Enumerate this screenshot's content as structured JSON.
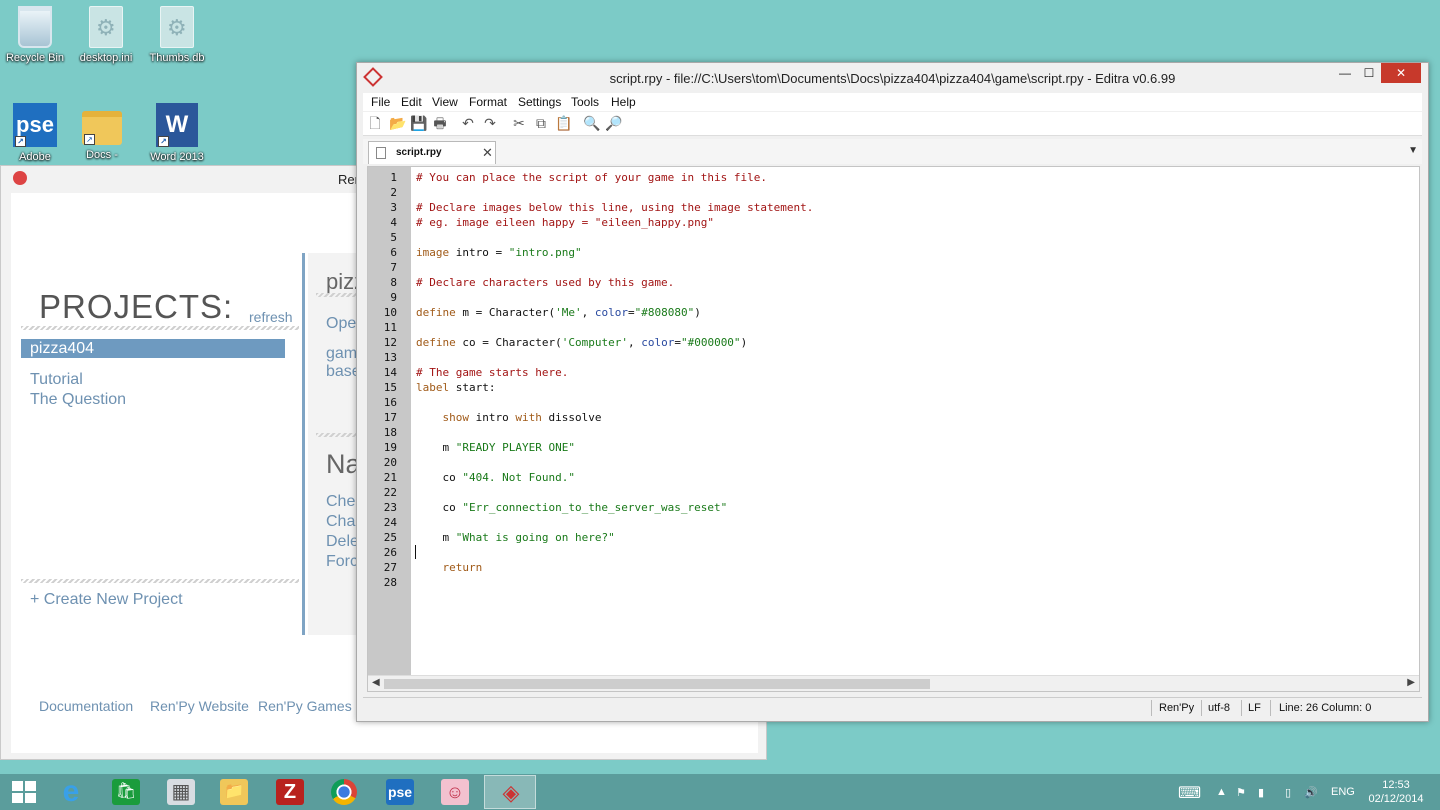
{
  "desktop": {
    "icons": [
      {
        "label": "Recycle Bin",
        "icon": "recycle-bin-icon"
      },
      {
        "label": "desktop.ini",
        "icon": "settings-file-icon"
      },
      {
        "label": "Thumbs.db",
        "icon": "settings-file-icon"
      },
      {
        "label": "Adobe",
        "icon": "photoshop-elements-icon",
        "glyph": "pse"
      },
      {
        "label": "Docs -",
        "icon": "folder-icon"
      },
      {
        "label": "Word 2013",
        "icon": "word-icon",
        "glyph": "W"
      }
    ]
  },
  "launcher": {
    "title": "Ren",
    "projects_heading": "PROJECTS:",
    "refresh": "refresh",
    "selected_project": "pizza404",
    "other_projects": [
      "Tutorial",
      "The Question"
    ],
    "panel": {
      "title": "pizz",
      "open": "Ope",
      "game": "gam",
      "base": "base",
      "nav_heading": "Na",
      "nav_items": [
        "Chec",
        "Char",
        "Dele",
        "Forc"
      ]
    },
    "create_project": "+ Create New Project",
    "footer_links": [
      "Documentation",
      "Ren'Py Website",
      "Ren'Py Games Li"
    ]
  },
  "editra": {
    "title": "script.rpy - file://C:\\Users\\tom\\Documents\\Docs\\pizza404\\pizza404\\game\\script.rpy - Editra v0.6.99",
    "window_buttons": {
      "minimize": "—",
      "maximize": "☐",
      "close": "✕"
    },
    "menu": [
      "File",
      "Edit",
      "View",
      "Format",
      "Settings",
      "Tools",
      "Help"
    ],
    "toolbar": [
      {
        "name": "new-file-icon",
        "glyph": "🗋"
      },
      {
        "name": "open-folder-icon",
        "glyph": "📂"
      },
      {
        "name": "save-icon",
        "glyph": "💾"
      },
      {
        "name": "print-icon",
        "glyph": "🖶"
      },
      {
        "name": "undo-icon",
        "glyph": "↶"
      },
      {
        "name": "redo-icon",
        "glyph": "↷"
      },
      {
        "name": "cut-icon",
        "glyph": "✂"
      },
      {
        "name": "copy-icon",
        "glyph": "⧉"
      },
      {
        "name": "paste-icon",
        "glyph": "📋"
      },
      {
        "name": "find-icon",
        "glyph": "🔍"
      },
      {
        "name": "find-replace-icon",
        "glyph": "🔎"
      }
    ],
    "tab": {
      "label": "script.rpy",
      "close": "✕"
    },
    "tab_dropdown": "▼",
    "lines": [
      [
        {
          "t": "# You can place the script of your game in this file.",
          "c": "comment"
        }
      ],
      [],
      [
        {
          "t": "# Declare images below this line, using the image statement.",
          "c": "comment"
        }
      ],
      [
        {
          "t": "# eg. image eileen happy = \"eileen_happy.png\"",
          "c": "comment"
        }
      ],
      [],
      [
        {
          "t": "image",
          "c": "kw"
        },
        {
          "t": " intro = ",
          "c": ""
        },
        {
          "t": "\"intro.png\"",
          "c": "str"
        }
      ],
      [],
      [
        {
          "t": "# Declare characters used by this game.",
          "c": "comment"
        }
      ],
      [],
      [
        {
          "t": "define",
          "c": "kw"
        },
        {
          "t": " m = Character(",
          "c": ""
        },
        {
          "t": "'Me'",
          "c": "str"
        },
        {
          "t": ", ",
          "c": ""
        },
        {
          "t": "color",
          "c": "attr"
        },
        {
          "t": "=",
          "c": ""
        },
        {
          "t": "\"#808080\"",
          "c": "str"
        },
        {
          "t": ")",
          "c": ""
        }
      ],
      [],
      [
        {
          "t": "define",
          "c": "kw"
        },
        {
          "t": " co = Character(",
          "c": ""
        },
        {
          "t": "'Computer'",
          "c": "str"
        },
        {
          "t": ", ",
          "c": ""
        },
        {
          "t": "color",
          "c": "attr"
        },
        {
          "t": "=",
          "c": ""
        },
        {
          "t": "\"#000000\"",
          "c": "str"
        },
        {
          "t": ")",
          "c": ""
        }
      ],
      [],
      [
        {
          "t": "# The game starts here.",
          "c": "comment"
        }
      ],
      [
        {
          "t": "label",
          "c": "kw"
        },
        {
          "t": " start:",
          "c": ""
        }
      ],
      [],
      [
        {
          "t": "    ",
          "c": ""
        },
        {
          "t": "show",
          "c": "kw"
        },
        {
          "t": " intro ",
          "c": ""
        },
        {
          "t": "with",
          "c": "kw"
        },
        {
          "t": " dissolve",
          "c": ""
        }
      ],
      [],
      [
        {
          "t": "    m ",
          "c": ""
        },
        {
          "t": "\"READY PLAYER ONE\"",
          "c": "str"
        }
      ],
      [],
      [
        {
          "t": "    co ",
          "c": ""
        },
        {
          "t": "\"404. Not Found.\"",
          "c": "str"
        }
      ],
      [],
      [
        {
          "t": "    co ",
          "c": ""
        },
        {
          "t": "\"Err_connection_to_the_server_was_reset\"",
          "c": "str"
        }
      ],
      [],
      [
        {
          "t": "    m ",
          "c": ""
        },
        {
          "t": "\"What is going on here?\"",
          "c": "str"
        }
      ],
      [],
      [
        {
          "t": "    ",
          "c": ""
        },
        {
          "t": "return",
          "c": "kw"
        }
      ],
      []
    ],
    "scroll_left": "◀",
    "scroll_right": "▶",
    "status": {
      "lexer": "Ren'Py",
      "encoding": "utf-8",
      "eol": "LF",
      "position": "Line: 26  Column: 0"
    }
  },
  "taskbar": {
    "apps": [
      {
        "name": "start-button",
        "icon": "windows-logo-icon"
      },
      {
        "name": "internet-explorer",
        "icon": "internet-explorer-icon",
        "glyph": "e"
      },
      {
        "name": "store",
        "icon": "store-icon",
        "glyph": "🛍"
      },
      {
        "name": "calculator",
        "icon": "calculator-icon",
        "glyph": "▦"
      },
      {
        "name": "file-explorer",
        "icon": "folder-icon",
        "glyph": "📁"
      },
      {
        "name": "filezilla",
        "icon": "filezilla-icon",
        "glyph": "Z"
      },
      {
        "name": "chrome",
        "icon": "chrome-icon",
        "glyph": "◎"
      },
      {
        "name": "photoshop-elements",
        "icon": "photoshop-elements-icon",
        "glyph": "pse"
      },
      {
        "name": "renpy",
        "icon": "renpy-icon",
        "glyph": "☺"
      },
      {
        "name": "editra",
        "icon": "editra-icon",
        "glyph": "◈"
      }
    ],
    "tray": {
      "language": "ENG",
      "time": "12:53",
      "date": "02/12/2014"
    }
  },
  "colors": {
    "desktop": "#7ccbc7",
    "taskbar": "#5b9d9c",
    "renpy_accent": "#6e9ac0",
    "close_red": "#c7392b",
    "comment": "#a21515",
    "keyword": "#a05a18",
    "string": "#1a7a1a"
  }
}
